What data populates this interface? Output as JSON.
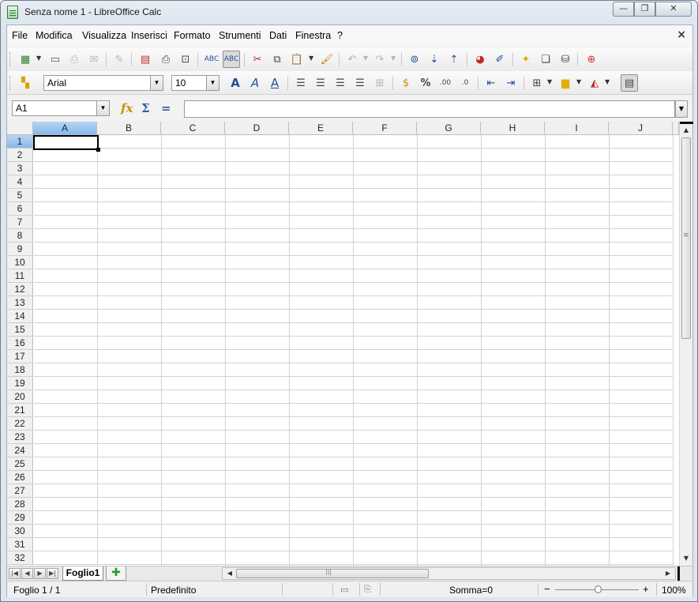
{
  "window": {
    "title": "Senza nome 1 - LibreOffice Calc",
    "minimize": "▭",
    "maximize": "⧉",
    "close": "✕"
  },
  "menu": {
    "items": [
      "File",
      "Modifica",
      "Visualizza",
      "Inserisci",
      "Formato",
      "Strumenti",
      "Dati",
      "Finestra",
      "?"
    ],
    "close": "×"
  },
  "toolbar": {
    "font_name": "Arial",
    "font_size": "10"
  },
  "formula_bar": {
    "cell_ref": "A1",
    "content": ""
  },
  "grid": {
    "columns": [
      "A",
      "B",
      "C",
      "D",
      "E",
      "F",
      "G",
      "H",
      "I",
      "J"
    ],
    "rows": [
      "1",
      "2",
      "3",
      "4",
      "5",
      "6",
      "7",
      "8",
      "9",
      "10",
      "11",
      "12",
      "13",
      "14",
      "15",
      "16",
      "17",
      "18",
      "19",
      "20",
      "21",
      "22",
      "23",
      "24",
      "25",
      "26",
      "27",
      "28",
      "29",
      "30",
      "31",
      "32"
    ],
    "selected_cell": "A1"
  },
  "sheets": {
    "tabs": [
      "Foglio1"
    ],
    "active": "Foglio1"
  },
  "status": {
    "sheet_info": "Foglio 1 / 1",
    "page_style": "Predefinito",
    "sum": "Somma=0",
    "zoom": "100%"
  }
}
